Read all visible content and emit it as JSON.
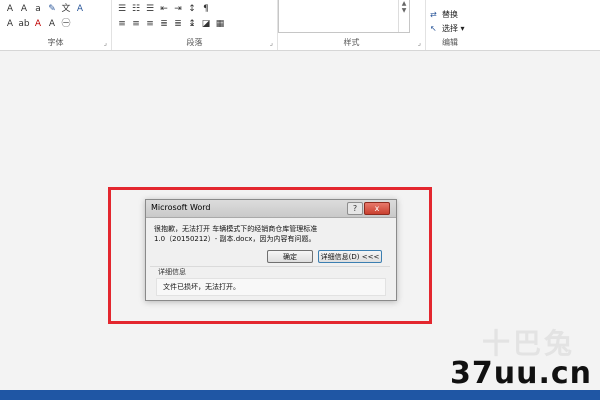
{
  "ribbon": {
    "font_group": "字体",
    "paragraph_group": "段落",
    "styles_group": "样式",
    "editing_group": "编辑",
    "edit_items": [
      "替换",
      "选择 ▾"
    ]
  },
  "dialog": {
    "title": "Microsoft Word",
    "help": "?",
    "close": "x",
    "message_line1": "很抱歉，无法打开 车辆模式下的经销商仓库管理标准",
    "message_line2": "1.0（20150212）- 副本.docx，因为内容有问题。",
    "ok_label": "确定",
    "details_label": "详细信息(D) <<<",
    "details_title": "详细信息",
    "details_text": "文件已损坏，无法打开。"
  },
  "watermark": {
    "top": "十巴兔",
    "site": "37uu.cn"
  },
  "colors": {
    "highlight": "#e3262e",
    "taskbar": "#1f56a4"
  }
}
